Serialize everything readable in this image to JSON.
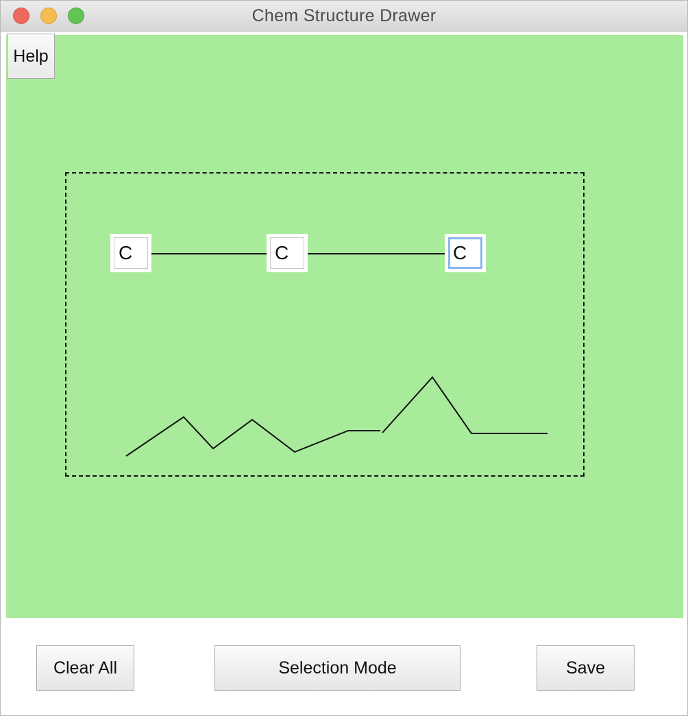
{
  "window": {
    "title": "Chem Structure Drawer"
  },
  "canvas": {
    "background_color": "#a8eb9b",
    "help_label": "Help",
    "atoms": [
      {
        "symbol": "C"
      },
      {
        "symbol": "C"
      },
      {
        "symbol": "C",
        "focused": true
      }
    ]
  },
  "toolbar": {
    "clear_all_label": "Clear All",
    "selection_mode_label": "Selection Mode",
    "save_label": "Save"
  }
}
